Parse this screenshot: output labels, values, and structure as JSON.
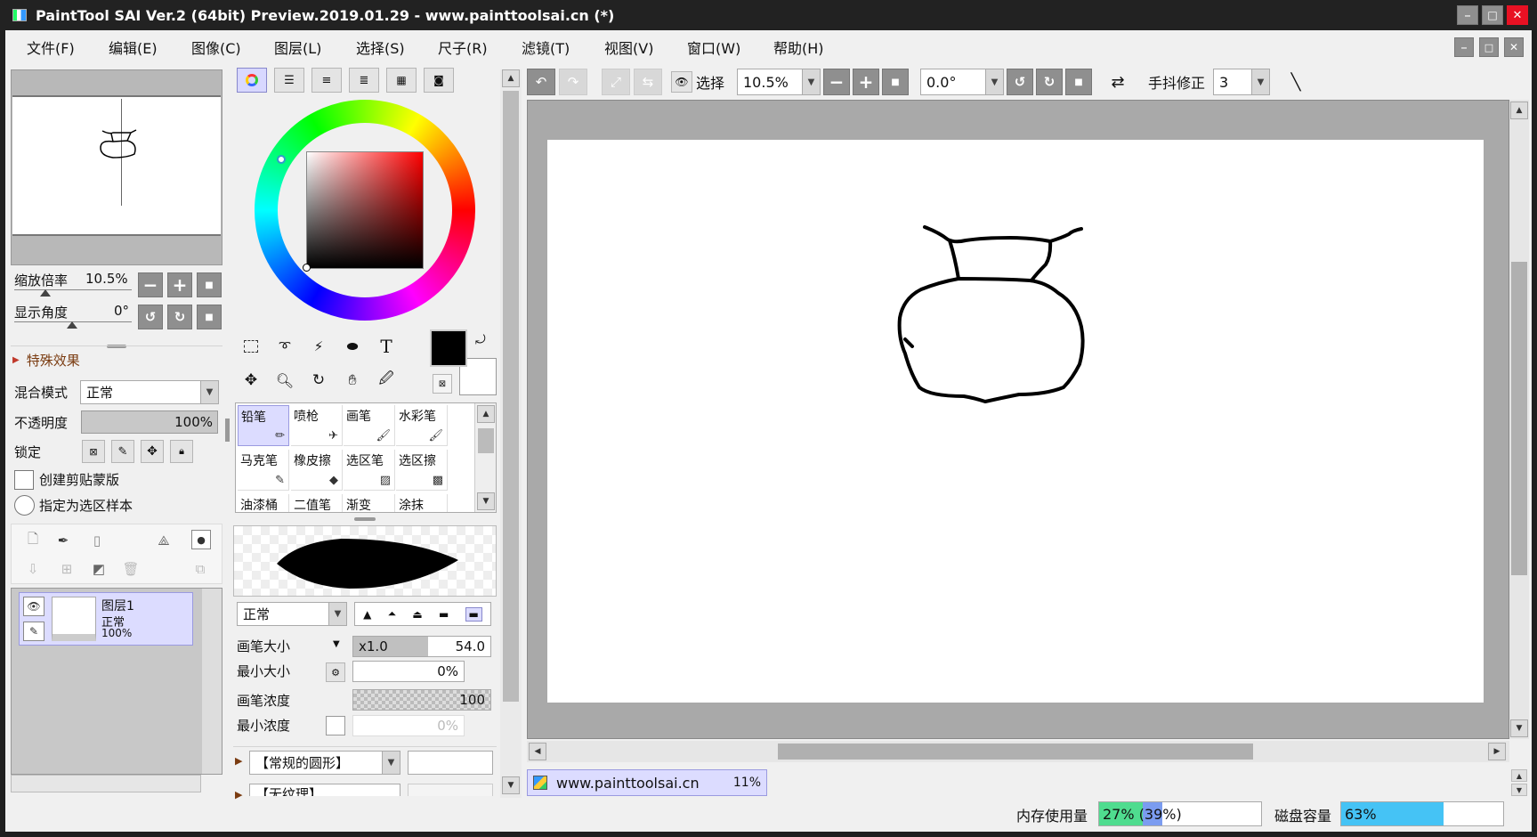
{
  "window": {
    "title": "PaintTool SAI Ver.2 (64bit) Preview.2019.01.29 - www.painttoolsai.cn (*)",
    "min_glyph": "–",
    "max_glyph": "□",
    "close_glyph": "✕"
  },
  "menu": [
    "文件(F)",
    "编辑(E)",
    "图像(C)",
    "图层(L)",
    "选择(S)",
    "尺子(R)",
    "滤镜(T)",
    "视图(V)",
    "窗口(W)",
    "帮助(H)"
  ],
  "navigator": {
    "zoom_label": "缩放倍率",
    "zoom_value": "10.5%",
    "angle_label": "显示角度",
    "angle_value": "0°"
  },
  "layer_panel": {
    "effects": "特殊效果",
    "blend_label": "混合模式",
    "blend_value": "正常",
    "opacity_label": "不透明度",
    "opacity_value": "100%",
    "lock_label": "锁定",
    "clip_label": "创建剪贴蒙版",
    "sample_label": "指定为选区样本",
    "layers": [
      {
        "name": "图层1",
        "mode": "正常",
        "opacity": "100%"
      }
    ]
  },
  "brushes": [
    "铅笔",
    "喷枪",
    "画笔",
    "水彩笔",
    "马克笔",
    "橡皮擦",
    "选区笔",
    "选区擦",
    "油漆桶",
    "二值笔",
    "渐变",
    "涂抹"
  ],
  "brush_settings": {
    "mode_value": "正常",
    "size_label": "画笔大小",
    "size_mult": "x1.0",
    "size_value": "54.0",
    "min_size_label": "最小大小",
    "min_size_value": "0%",
    "density_label": "画笔浓度",
    "density_value": "100",
    "min_density_label": "最小浓度",
    "min_density_value": "0%",
    "shape_value": "【常规的圆形】",
    "texture_value": "【无纹理】"
  },
  "toolbar": {
    "select_label": "选择",
    "zoom_value": "10.5%",
    "angle_value": "0.0°",
    "stabilizer_label": "手抖修正",
    "stabilizer_value": "3"
  },
  "doc_tab": {
    "name": "www.painttoolsai.cn",
    "percent": "11%"
  },
  "status": {
    "memory_label": "内存使用量",
    "memory_value": "27% (39%)",
    "memory_fraction": 0.27,
    "memory_fraction2": 0.39,
    "disk_label": "磁盘容量",
    "disk_value": "63%",
    "disk_fraction": 0.63
  },
  "colors": {
    "primary": "#000000",
    "secondary": "#ffffff",
    "accent": "#dcdcff"
  }
}
